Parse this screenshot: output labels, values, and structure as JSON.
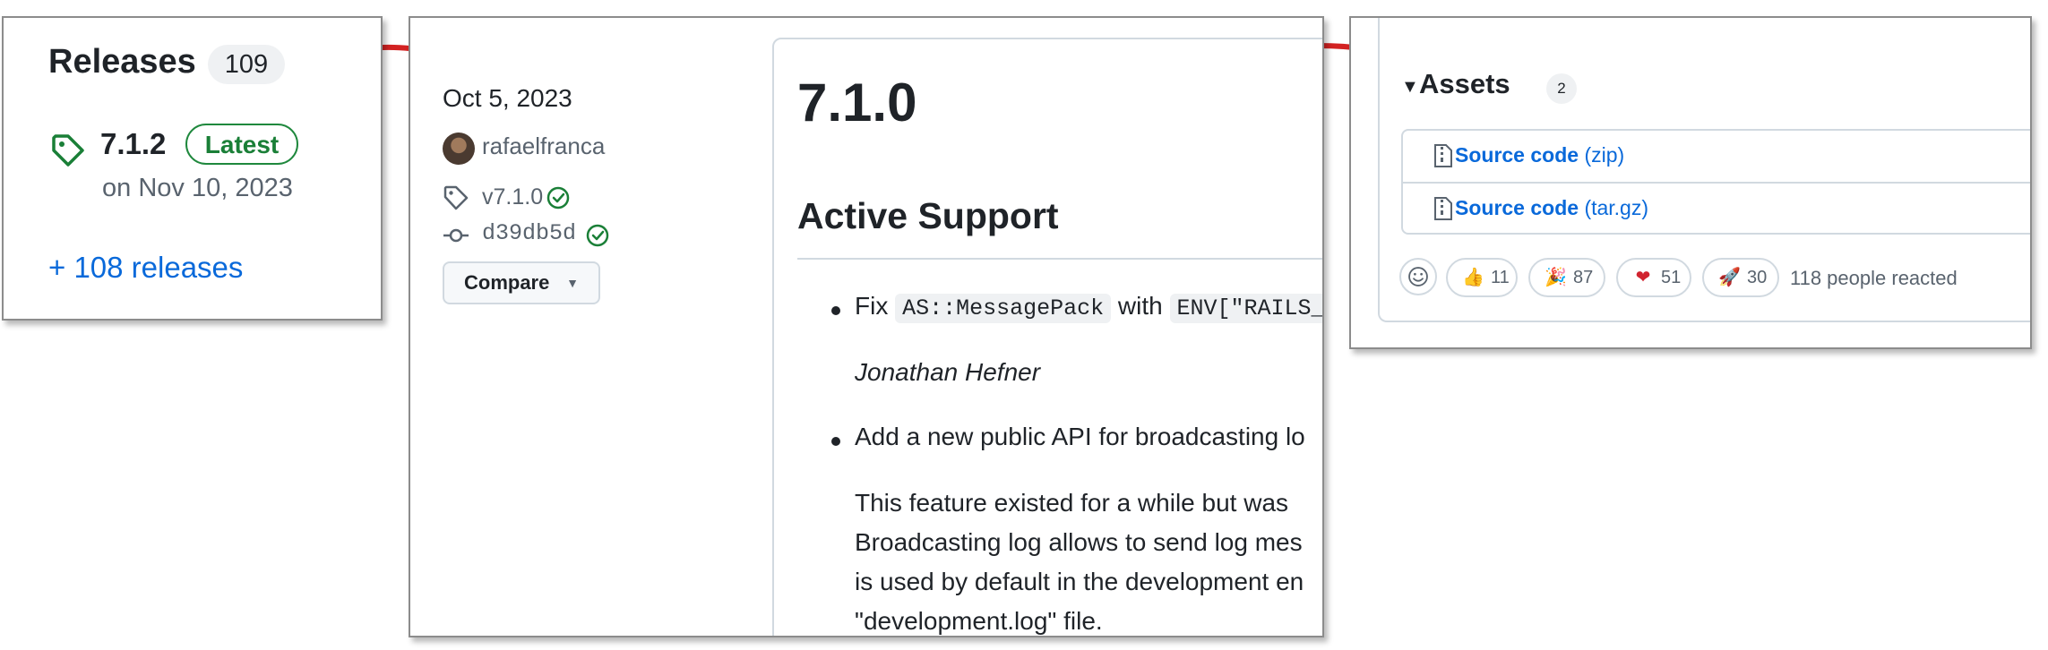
{
  "releases_panel": {
    "title": "Releases",
    "count": "109",
    "latest_version": "7.1.2",
    "latest_badge": "Latest",
    "latest_date": "on Nov 10, 2023",
    "more_link": "+ 108 releases"
  },
  "release_panel": {
    "date": "Oct 5, 2023",
    "author": "rafaelfranca",
    "tag": "v7.1.0",
    "commit": "d39db5d",
    "compare_button": "Compare",
    "title": "7.1.0",
    "section_title": "Active Support",
    "item1_prefix": "Fix ",
    "item1_code1": "AS::MessagePack",
    "item1_mid": " with ",
    "item1_code2": "ENV[\"RAILS_",
    "item1_author": "Jonathan Hefner",
    "item2": "Add a new public API for broadcasting lo",
    "para_line1": "This feature existed for a while but was",
    "para_line2": "Broadcasting log allows to send log mes",
    "para_line3": "is used by default in the development en",
    "para_line4": "\"development.log\" file."
  },
  "assets_panel": {
    "title": "Assets",
    "count": "2",
    "assets": [
      {
        "name": "Source code",
        "format": "(zip)"
      },
      {
        "name": "Source code",
        "format": "(tar.gz)"
      }
    ],
    "reactions": [
      {
        "icon": "thumbs-up-icon",
        "count": "11"
      },
      {
        "icon": "party-popper-icon",
        "count": "87"
      },
      {
        "icon": "heart-icon",
        "count": "51"
      },
      {
        "icon": "rocket-icon",
        "count": "30"
      }
    ],
    "reacted_text": "118 people reacted"
  },
  "colors": {
    "link": "#0969da",
    "success": "#1a7f37",
    "arrow": "#d32222",
    "muted": "#59636e"
  }
}
